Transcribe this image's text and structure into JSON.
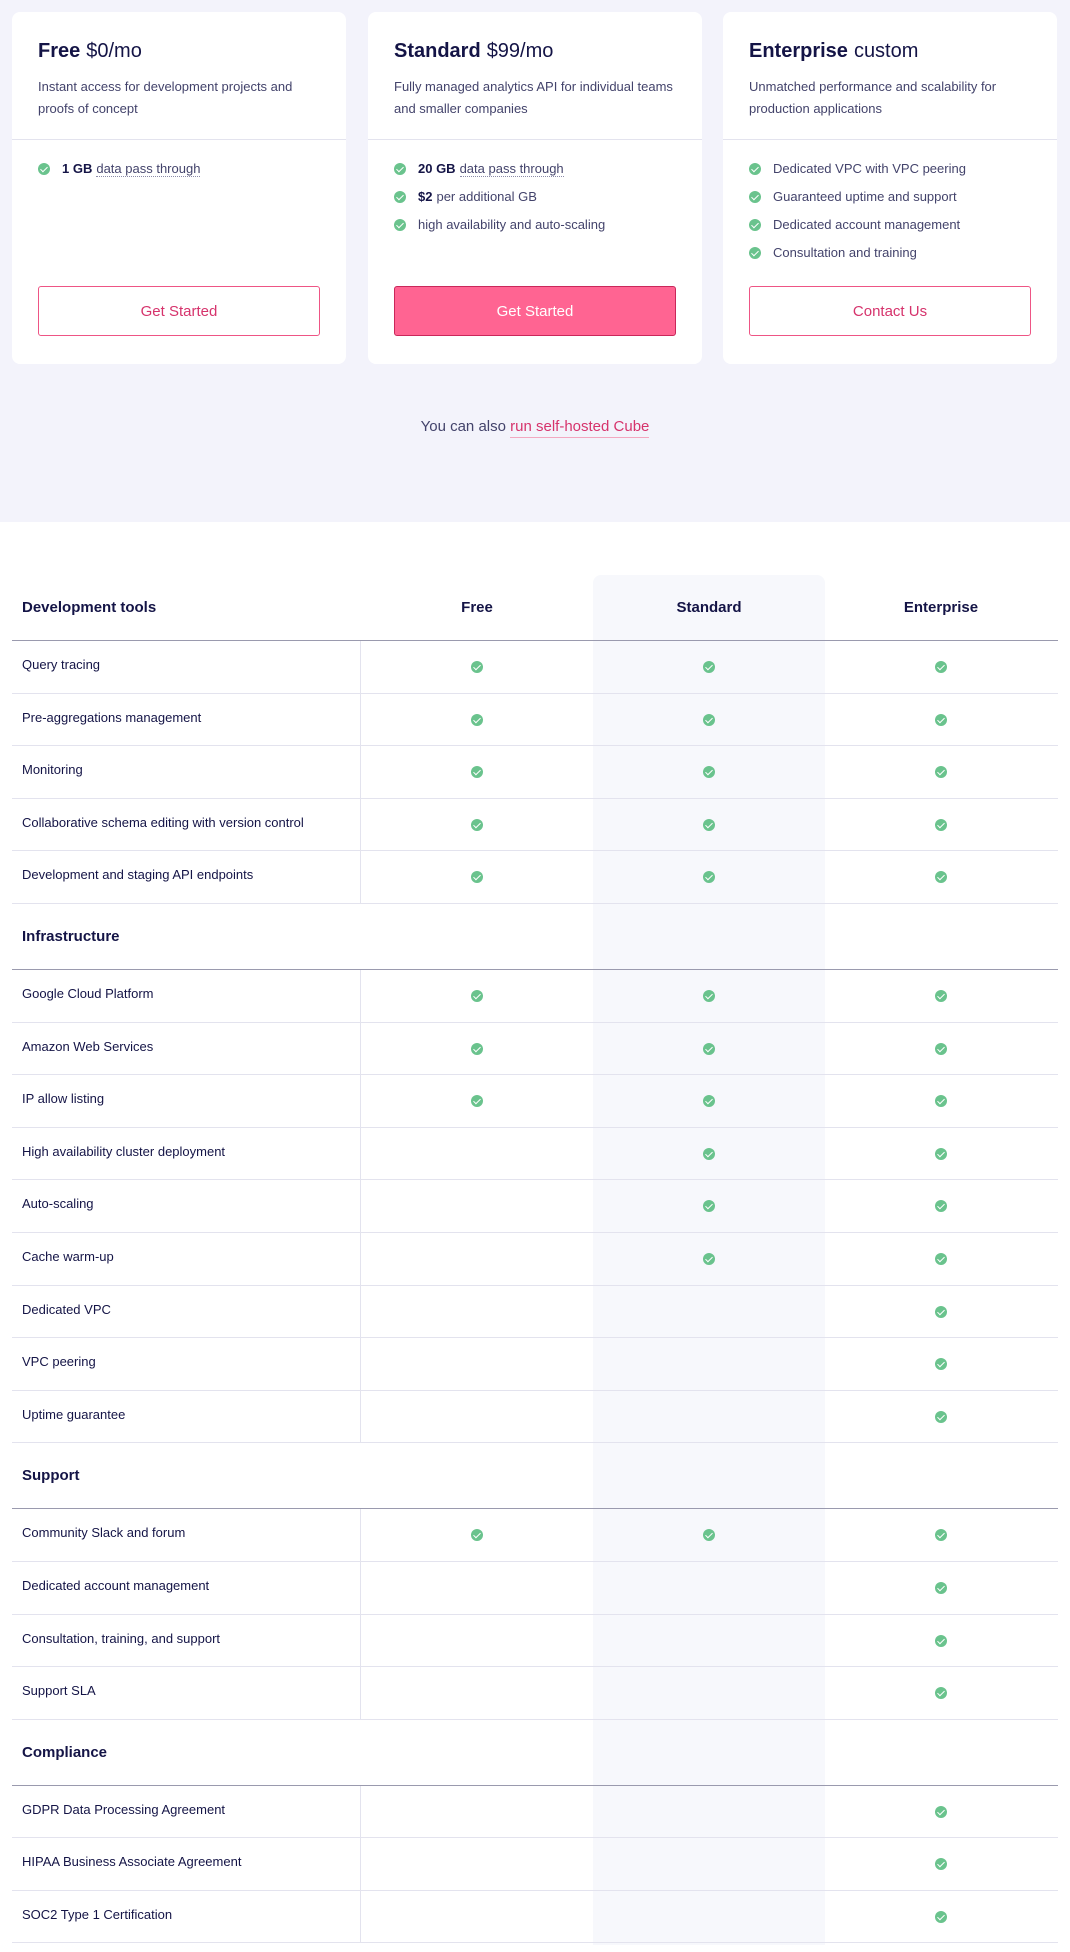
{
  "plans": [
    {
      "name": "Free",
      "price": "$0/mo",
      "description": "Instant access for development projects and proofs of concept",
      "features": [
        {
          "bold": "1 GB",
          "text": "data pass through",
          "dotted": true
        }
      ],
      "button": "Get Started"
    },
    {
      "name": "Standard",
      "price": "$99/mo",
      "description": "Fully managed analytics API for individual teams and smaller companies",
      "features": [
        {
          "bold": "20 GB",
          "text": "data pass through",
          "dotted": true
        },
        {
          "bold": "$2",
          "text": "per additional GB",
          "dotted": false
        },
        {
          "bold": "",
          "text": "high availability and auto-scaling",
          "dotted": false
        }
      ],
      "button": "Get Started"
    },
    {
      "name": "Enterprise",
      "price": "custom",
      "description": "Unmatched performance and scalability for production applications",
      "features": [
        {
          "bold": "",
          "text": "Dedicated VPC with VPC peering",
          "dotted": false
        },
        {
          "bold": "",
          "text": "Guaranteed uptime and support",
          "dotted": false
        },
        {
          "bold": "",
          "text": "Dedicated account management",
          "dotted": false
        },
        {
          "bold": "",
          "text": "Consultation and training",
          "dotted": false
        }
      ],
      "button": "Contact Us"
    }
  ],
  "self_hosted": {
    "prefix": "You can also",
    "link": "run self-hosted Cube"
  },
  "table": {
    "columns": [
      "Free",
      "Standard",
      "Enterprise"
    ],
    "sections": [
      {
        "title": "Development tools",
        "rows": [
          {
            "label": "Query tracing",
            "free": true,
            "standard": true,
            "enterprise": true
          },
          {
            "label": "Pre-aggregations management",
            "free": true,
            "standard": true,
            "enterprise": true
          },
          {
            "label": "Monitoring",
            "free": true,
            "standard": true,
            "enterprise": true
          },
          {
            "label": "Collaborative schema editing with version control",
            "free": true,
            "standard": true,
            "enterprise": true
          },
          {
            "label": "Development and staging API endpoints",
            "free": true,
            "standard": true,
            "enterprise": true
          }
        ]
      },
      {
        "title": "Infrastructure",
        "rows": [
          {
            "label": "Google Cloud Platform",
            "free": true,
            "standard": true,
            "enterprise": true
          },
          {
            "label": "Amazon Web Services",
            "free": true,
            "standard": true,
            "enterprise": true
          },
          {
            "label": "IP allow listing",
            "free": true,
            "standard": true,
            "enterprise": true
          },
          {
            "label": "High availability cluster deployment",
            "free": false,
            "standard": true,
            "enterprise": true
          },
          {
            "label": "Auto-scaling",
            "free": false,
            "standard": true,
            "enterprise": true
          },
          {
            "label": "Cache warm-up",
            "free": false,
            "standard": true,
            "enterprise": true
          },
          {
            "label": "Dedicated VPC",
            "free": false,
            "standard": false,
            "enterprise": true
          },
          {
            "label": "VPC peering",
            "free": false,
            "standard": false,
            "enterprise": true
          },
          {
            "label": "Uptime guarantee",
            "free": false,
            "standard": false,
            "enterprise": true
          }
        ]
      },
      {
        "title": "Support",
        "rows": [
          {
            "label": "Community Slack and forum",
            "free": true,
            "standard": true,
            "enterprise": true
          },
          {
            "label": "Dedicated account management",
            "free": false,
            "standard": false,
            "enterprise": true
          },
          {
            "label": "Consultation, training, and support",
            "free": false,
            "standard": false,
            "enterprise": true
          },
          {
            "label": "Support SLA",
            "free": false,
            "standard": false,
            "enterprise": true
          }
        ]
      },
      {
        "title": "Compliance",
        "rows": [
          {
            "label": "GDPR Data Processing Agreement",
            "free": false,
            "standard": false,
            "enterprise": true
          },
          {
            "label": "HIPAA Business Associate Agreement",
            "free": false,
            "standard": false,
            "enterprise": true
          },
          {
            "label": "SOC2 Type 1 Certification",
            "free": false,
            "standard": false,
            "enterprise": true
          }
        ]
      }
    ]
  },
  "colors": {
    "accent": "#d6336c",
    "primary_button": "#ff6492",
    "check": "#6ac38d",
    "text_dark": "#141446",
    "background_top": "#f3f3fb"
  }
}
